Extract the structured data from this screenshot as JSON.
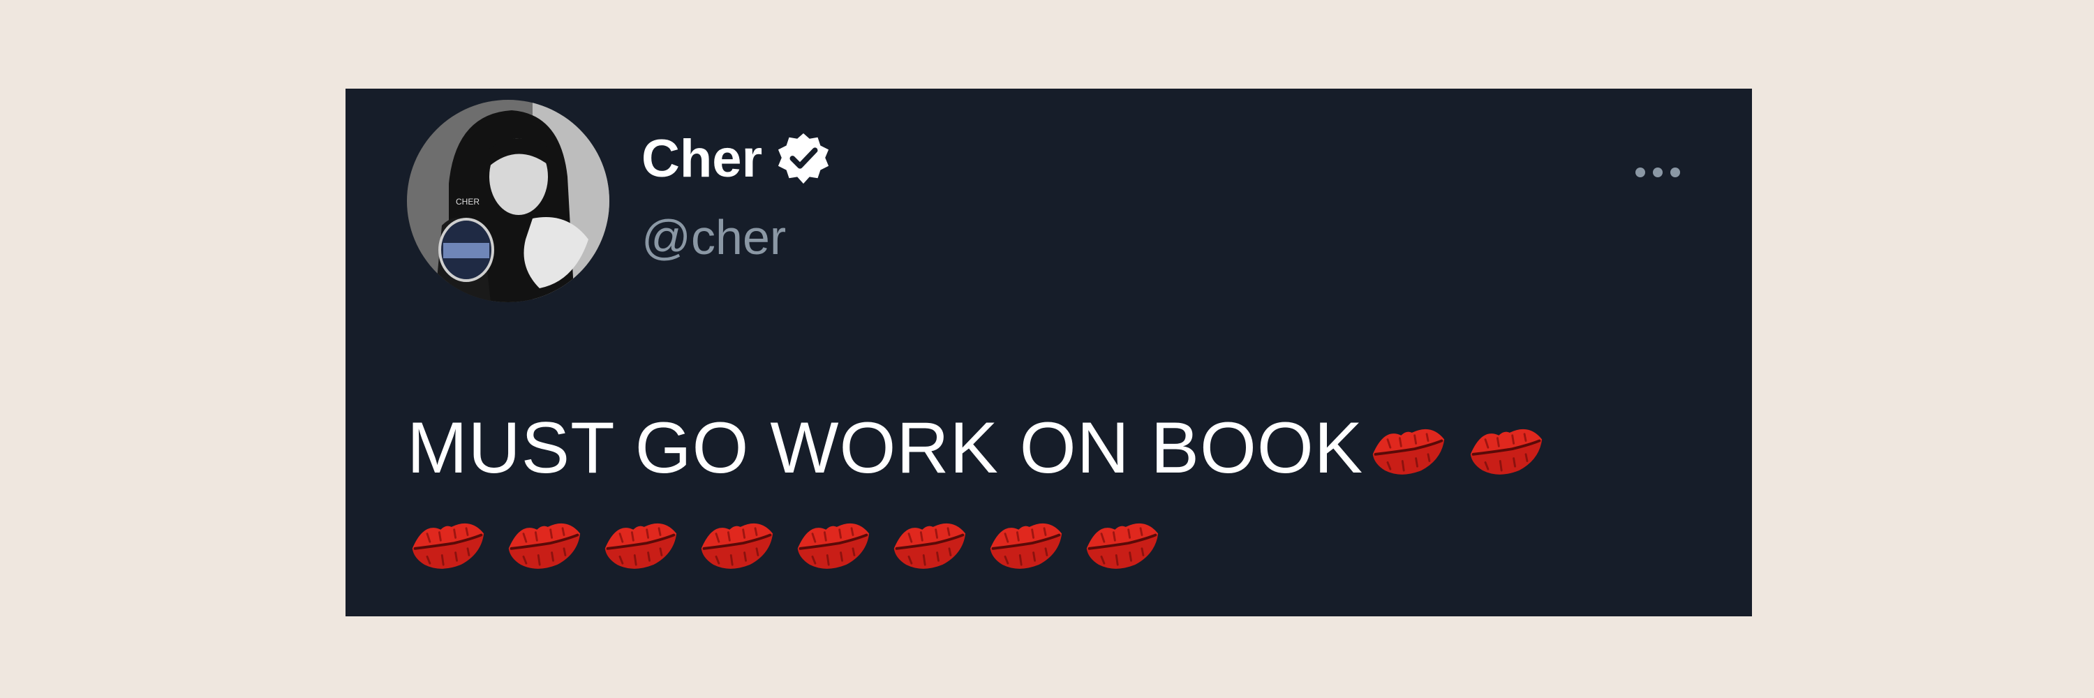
{
  "tweet": {
    "author": {
      "display_name": "Cher",
      "handle": "@cher",
      "verified": true,
      "avatar_icon": "profile-photo-icon"
    },
    "text": "MUST GO WORK ON BOOK",
    "emoji": {
      "name": "kiss-mark-icon",
      "count_line1": 2,
      "count_line2": 8,
      "color": "#e0281e"
    },
    "more_icon": "more-options-icon"
  },
  "colors": {
    "page_background": "#efe7df",
    "card_background": "#161d29",
    "text_primary": "#ffffff",
    "text_secondary": "#8b98a5"
  }
}
